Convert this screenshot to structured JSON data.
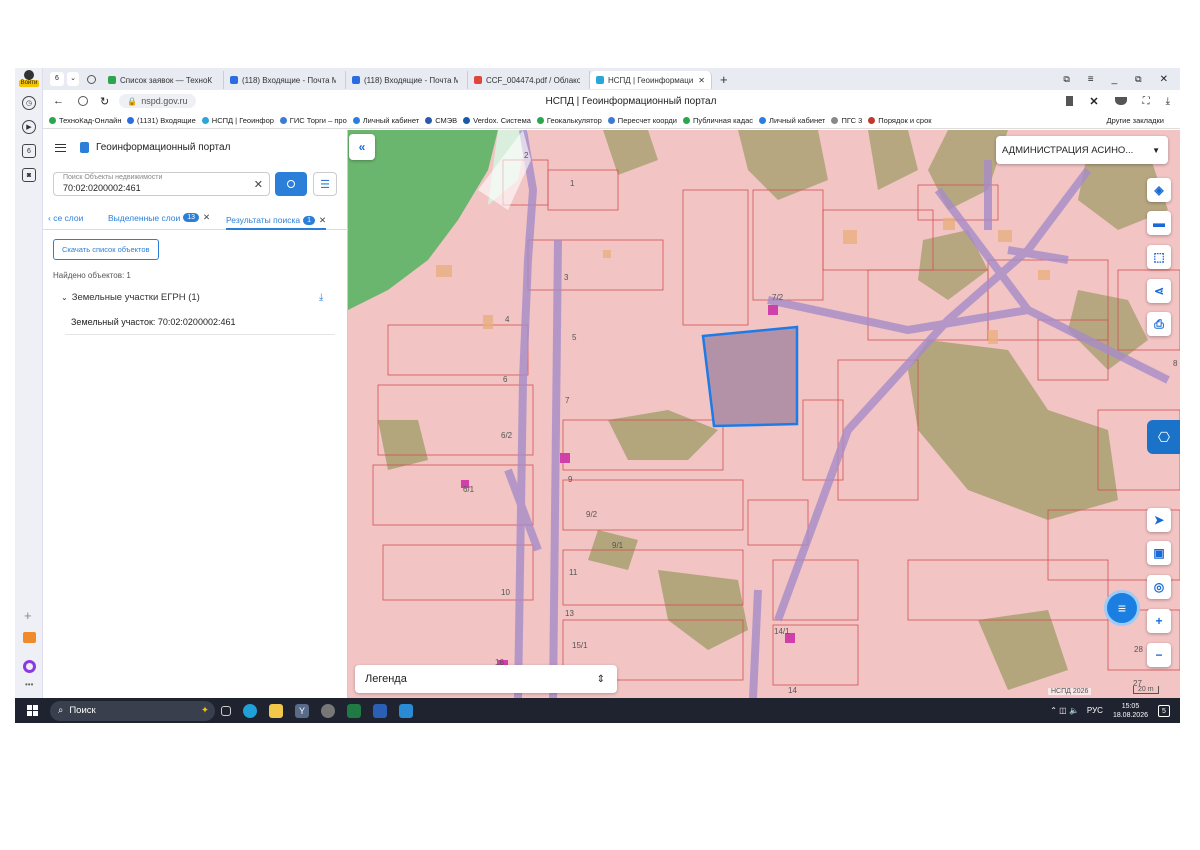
{
  "browser": {
    "login_label": "Войти",
    "tab_count": "6",
    "tabs": [
      {
        "title": "Список заявок — ТехноК",
        "color": "#2ea44f"
      },
      {
        "title": "(118) Входящие - Почта М",
        "color": "#2b6de0"
      },
      {
        "title": "(118) Входящие - Почта М",
        "color": "#2b6de0"
      },
      {
        "title": "CCF_004474.pdf / Облако",
        "color": "#e0453a"
      },
      {
        "title": "НСПД | Геоинформаци",
        "color": "#2aa6d9"
      }
    ],
    "new_tab": "+",
    "url": "nspd.gov.ru",
    "page_title": "НСПД | Геоинформационный портал",
    "bookmarks": [
      {
        "label": "ТехноКад-Онлайн",
        "color": "#2ea44f"
      },
      {
        "label": "(1131) Входящие",
        "color": "#2b6de0"
      },
      {
        "label": "НСПД | Геоинфор",
        "color": "#2aa6d9"
      },
      {
        "label": "ГИС Торги – про",
        "color": "#3a7bd5"
      },
      {
        "label": "Личный кабинет",
        "color": "#2b7fd9"
      },
      {
        "label": "СМЭВ",
        "color": "#2d5aa8"
      },
      {
        "label": "Verdox. Система",
        "color": "#1a5ba8"
      },
      {
        "label": "Геокалькулятор",
        "color": "#2ea44f"
      },
      {
        "label": "Пересчет коорди",
        "color": "#3a7bd5"
      },
      {
        "label": "Публичная кадас",
        "color": "#2ea44f"
      },
      {
        "label": "Личный кабинет",
        "color": "#2b7fd9"
      },
      {
        "label": "ПГС 3",
        "color": "#888888"
      },
      {
        "label": "Порядок и срок",
        "color": "#c0392b"
      }
    ],
    "other_bookmarks": "Другие закладки"
  },
  "portal": {
    "title": "Геоинформационный портал",
    "search": {
      "placeholder": "Поиск Объекты недвижимости",
      "value": "70:02:0200002:461"
    },
    "tabs": [
      {
        "label": "се слои"
      },
      {
        "label": "Выделенные слои",
        "badge": "13"
      },
      {
        "label": "Результаты поиска",
        "badge": "1"
      }
    ],
    "download_button": "Скачать список объектов",
    "found_text": "Найдено объектов: 1",
    "group_label": "Земельные участки ЕГРН (1)",
    "result_item": "Земельный участок: 70:02:0200002:461"
  },
  "map": {
    "admin_dropdown": "АДМИНИСТРАЦИЯ АСИНО...",
    "legend_label": "Легенда",
    "copyright": "НСПД 2026",
    "scale": "20 m",
    "parcel_labels": [
      "2",
      "1",
      "3",
      "4",
      "5",
      "6",
      "7",
      "6/2",
      "6/1",
      "9",
      "9/2",
      "9/1",
      "11",
      "10",
      "13",
      "15/1",
      "16",
      "14",
      "14/1",
      "7/2",
      "8",
      "28",
      "27"
    ]
  },
  "taskbar": {
    "search_label": "Поиск",
    "lang": "РУС",
    "time": "15:05",
    "date": "18.08.2026",
    "notif": "5"
  }
}
